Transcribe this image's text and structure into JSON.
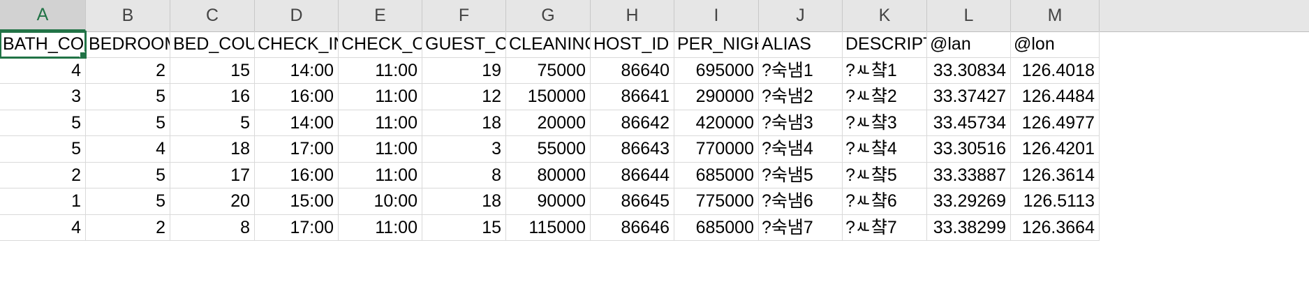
{
  "columns": [
    "A",
    "B",
    "C",
    "D",
    "E",
    "F",
    "G",
    "H",
    "I",
    "J",
    "K",
    "L",
    "M"
  ],
  "headers": [
    "BATH_COUNT",
    "BEDROOM",
    "BED_COUNT",
    "CHECK_IN_",
    "CHECK_OUT",
    "GUEST_CO",
    "CLEANING",
    "HOST_ID",
    "PER_NIGHT",
    "ALIAS",
    "DESCRIPTIO",
    "@lan",
    "@lon"
  ],
  "rows": [
    [
      "4",
      "2",
      "15",
      "14:00",
      "11:00",
      "19",
      "75000",
      "86640",
      "695000",
      "?숙냄1",
      "?ㅻ챸1",
      "33.30834",
      "126.4018"
    ],
    [
      "3",
      "5",
      "16",
      "16:00",
      "11:00",
      "12",
      "150000",
      "86641",
      "290000",
      "?숙냄2",
      "?ㅻ챸2",
      "33.37427",
      "126.4484"
    ],
    [
      "5",
      "5",
      "5",
      "14:00",
      "11:00",
      "18",
      "20000",
      "86642",
      "420000",
      "?숙냄3",
      "?ㅻ챸3",
      "33.45734",
      "126.4977"
    ],
    [
      "5",
      "4",
      "18",
      "17:00",
      "11:00",
      "3",
      "55000",
      "86643",
      "770000",
      "?숙냄4",
      "?ㅻ챸4",
      "33.30516",
      "126.4201"
    ],
    [
      "2",
      "5",
      "17",
      "16:00",
      "11:00",
      "8",
      "80000",
      "86644",
      "685000",
      "?숙냄5",
      "?ㅻ챸5",
      "33.33887",
      "126.3614"
    ],
    [
      "1",
      "5",
      "20",
      "15:00",
      "10:00",
      "18",
      "90000",
      "86645",
      "775000",
      "?숙냄6",
      "?ㅻ챸6",
      "33.29269",
      "126.5113"
    ],
    [
      "4",
      "2",
      "8",
      "17:00",
      "11:00",
      "15",
      "115000",
      "86646",
      "685000",
      "?숙냄7",
      "?ㅻ챸7",
      "33.38299",
      "126.3664"
    ]
  ],
  "selected_cell": "A1"
}
